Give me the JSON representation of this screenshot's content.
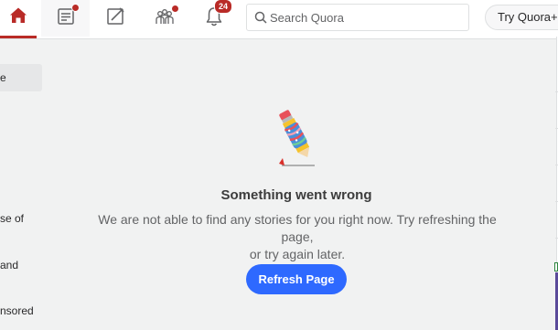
{
  "header": {
    "notification_count": "24",
    "search_placeholder": "Search Quora",
    "try_button": "Try Quora+"
  },
  "sidebar_fragments": {
    "active_item": "e",
    "item_1": "se of",
    "item_2": "and",
    "item_3": "nsored"
  },
  "error": {
    "title": "Something went wrong",
    "message_line_1": "We are not able to find any stories for you right now. Try refreshing the page,",
    "message_line_2": "or try again later.",
    "refresh_button": "Refresh Page"
  },
  "icons": {
    "home": "home-icon",
    "answer": "answer-icon",
    "write": "edit-pencil-icon",
    "spaces": "spaces-people-icon",
    "notifications": "bell-icon",
    "search": "search-icon",
    "illustration": "pencil-broken-illustration"
  },
  "colors": {
    "brand_red": "#b92b27",
    "primary_blue": "#2e69ff",
    "background": "#f1f2f2"
  }
}
